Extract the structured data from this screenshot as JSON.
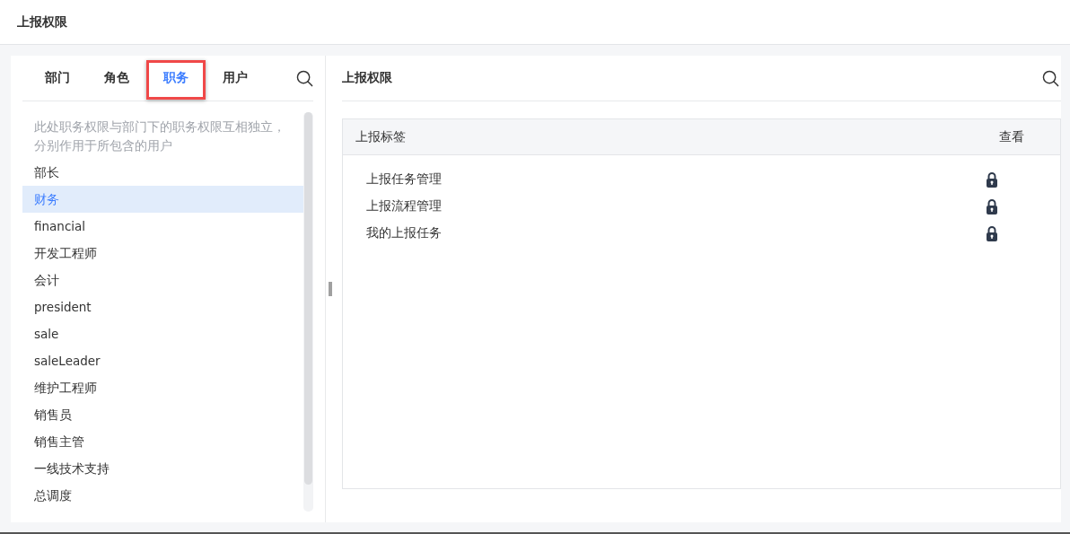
{
  "header": {
    "title": "上报权限"
  },
  "left_panel": {
    "tabs": [
      {
        "label": "部门",
        "selected": false
      },
      {
        "label": "角色",
        "selected": false
      },
      {
        "label": "职务",
        "selected": true
      },
      {
        "label": "用户",
        "selected": false
      }
    ],
    "hint": "此处职务权限与部门下的职务权限互相独立，分别作用于所包含的用户",
    "items": [
      {
        "label": "部长",
        "selected": false
      },
      {
        "label": "财务",
        "selected": true
      },
      {
        "label": "financial",
        "selected": false
      },
      {
        "label": "开发工程师",
        "selected": false
      },
      {
        "label": "会计",
        "selected": false
      },
      {
        "label": "president",
        "selected": false
      },
      {
        "label": "sale",
        "selected": false
      },
      {
        "label": "saleLeader",
        "selected": false
      },
      {
        "label": "维护工程师",
        "selected": false
      },
      {
        "label": "销售员",
        "selected": false
      },
      {
        "label": "销售主管",
        "selected": false
      },
      {
        "label": "一线技术支持",
        "selected": false
      },
      {
        "label": "总调度",
        "selected": false
      }
    ]
  },
  "right_panel": {
    "title": "上报权限",
    "table": {
      "columns": [
        "上报标签",
        "查看"
      ],
      "rows": [
        {
          "label": "上报任务管理",
          "locked": true
        },
        {
          "label": "上报流程管理",
          "locked": true
        },
        {
          "label": "我的上报任务",
          "locked": true
        }
      ]
    }
  }
}
